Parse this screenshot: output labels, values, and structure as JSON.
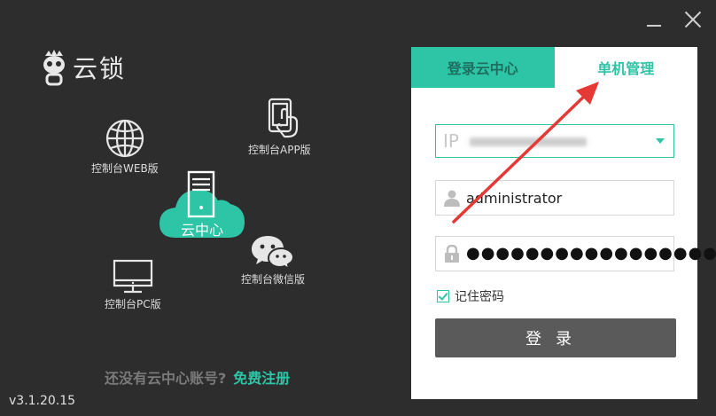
{
  "brand": {
    "name": "云锁"
  },
  "features": [
    {
      "label": "控制台WEB版",
      "icon": "globe-icon"
    },
    {
      "label": "控制台APP版",
      "icon": "tablet-touch-icon"
    },
    {
      "label": "云中心",
      "icon": "cloud-server-icon"
    },
    {
      "label": "控制台微信版",
      "icon": "wechat-icon"
    },
    {
      "label": "控制台PC版",
      "icon": "monitor-icon"
    }
  ],
  "signup": {
    "question": "还没有云中心账号?",
    "link": "免费注册"
  },
  "version": "v3.1.20.15",
  "login": {
    "tabs": [
      {
        "label": "登录云中心",
        "active": false
      },
      {
        "label": "单机管理",
        "active": true
      }
    ],
    "ip_prefix": "IP",
    "username": "administrator",
    "password_mask": "●●●●●●●●●●●●●●●●●●",
    "remember_label": "记住密码",
    "remember_checked": true,
    "submit_label": "登录"
  },
  "colors": {
    "accent": "#2ec4a6",
    "background": "#2d2d2d",
    "annotation_arrow": "#e53935"
  }
}
